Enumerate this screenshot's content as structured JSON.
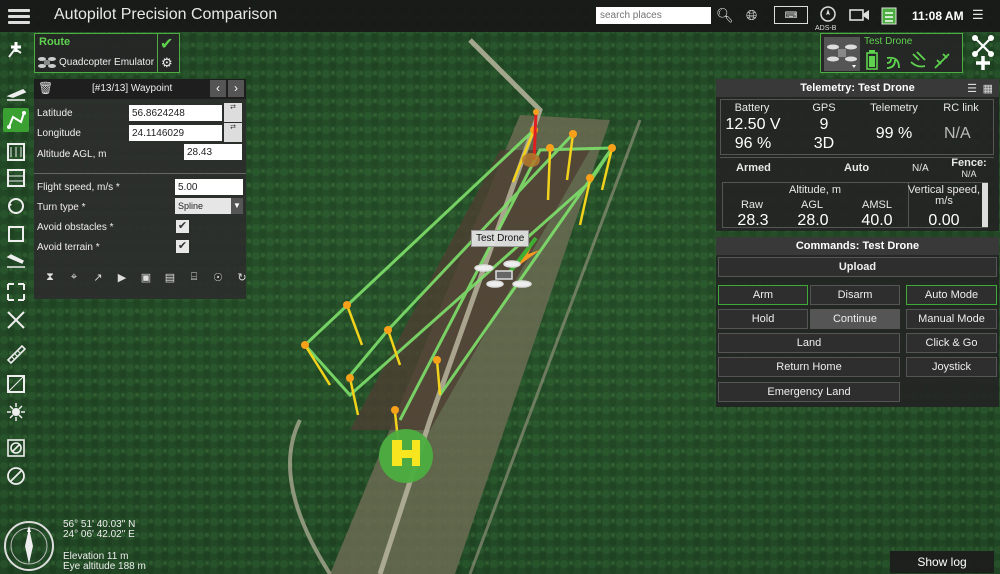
{
  "header": {
    "title": "Autopilot Precision Comparison",
    "search_placeholder": "search places",
    "adsb_label": "ADS-B",
    "time": "11:08 AM"
  },
  "route": {
    "title": "Route",
    "vehicle": "Quadcopter Emulator"
  },
  "waypoint_panel": {
    "title": "[#13/13] Waypoint",
    "fields": {
      "latitude_label": "Latitude",
      "latitude_value": "56.8624248",
      "longitude_label": "Longitude",
      "longitude_value": "24.1146029",
      "altitude_label": "Altitude AGL, m",
      "altitude_value": "28.43",
      "speed_label": "Flight speed, m/s *",
      "speed_value": "5.00",
      "turn_label": "Turn type *",
      "turn_value": "Spline",
      "avoid_obstacles_label": "Avoid obstacles *",
      "avoid_obstacles_checked": true,
      "avoid_terrain_label": "Avoid terrain *",
      "avoid_terrain_checked": true
    }
  },
  "drone": {
    "name": "Test Drone"
  },
  "telemetry": {
    "title": "Telemetry: Test Drone",
    "battery_label": "Battery",
    "battery_voltage": "12.50 V",
    "battery_percent": "96 %",
    "gps_label": "GPS",
    "gps_sats": "9",
    "gps_fix": "3D",
    "telemetry_label": "Telemetry",
    "telemetry_value": "99 %",
    "rc_label": "RC link",
    "rc_value": "N/A",
    "armed": "Armed",
    "mode": "Auto",
    "na1": "N/A",
    "fence_label": "Fence:",
    "fence_value": "N/A",
    "altitude_label": "Altitude, m",
    "raw_label": "Raw",
    "raw_value": "28.3",
    "agl_label": "AGL",
    "agl_value": "28.0",
    "amsl_label": "AMSL",
    "amsl_value": "40.0",
    "vspeed_label": "Vertical speed, m/s",
    "vspeed_value": "0.00"
  },
  "commands": {
    "title": "Commands: Test Drone",
    "upload": "Upload",
    "arm": "Arm",
    "disarm": "Disarm",
    "auto_mode": "Auto Mode",
    "hold": "Hold",
    "continue": "Continue",
    "manual_mode": "Manual Mode",
    "land": "Land",
    "click_go": "Click & Go",
    "return_home": "Return Home",
    "joystick": "Joystick",
    "emergency_land": "Emergency Land"
  },
  "map": {
    "drone_label": "Test Drone",
    "lat": "56° 51' 40.03\" N",
    "lon": "24° 06' 42.02\" E",
    "elevation": "Elevation 11 m",
    "eye_altitude": "Eye altitude 188 m"
  },
  "footer": {
    "show_log": "Show log"
  },
  "colors": {
    "accent_green": "#4cae40",
    "path_green": "#7ee06a",
    "marker_yellow": "#f2d21b",
    "home_yellow": "#f7e51f"
  }
}
